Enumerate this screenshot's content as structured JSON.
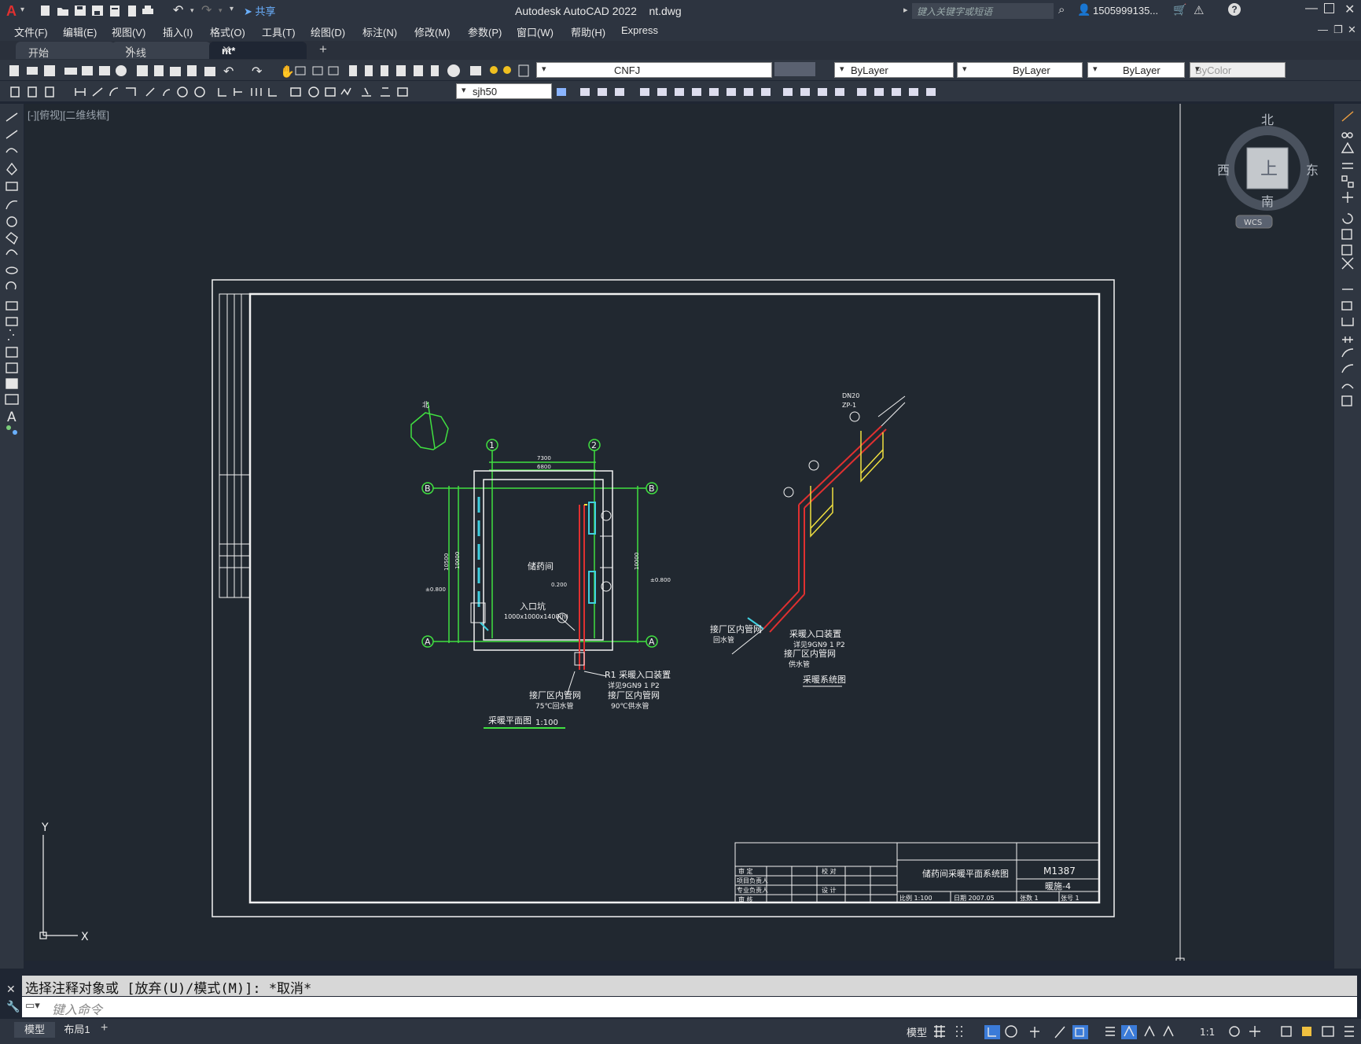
{
  "app": {
    "title": "Autodesk AutoCAD 2022    nt.dwg",
    "share": "共享",
    "search_placeholder": "键入关键字或短语",
    "user": "1505999135...",
    "colors": {
      "accent": "#e03030",
      "bg": "#1f2633",
      "canvas": "#212830"
    }
  },
  "menu": {
    "items": [
      "文件(F)",
      "编辑(E)",
      "视图(V)",
      "插入(I)",
      "格式(O)",
      "工具(T)",
      "绘图(D)",
      "标注(N)",
      "修改(M)",
      "参数(P)",
      "窗口(W)",
      "帮助(H)",
      "Express"
    ]
  },
  "tabs": [
    {
      "label": "开始"
    },
    {
      "label": "外线"
    },
    {
      "label": "nt*"
    }
  ],
  "toolbar": {
    "layer": "CNFJ",
    "color": "ByLayer",
    "linetype": "ByLayer",
    "lineweight": "ByLayer",
    "plotstyle": "ByColor",
    "textstyle": "sjh50"
  },
  "viewport": {
    "label": "[-][俯视][二维线框]",
    "viewcube": {
      "north": "北",
      "south": "南",
      "east": "东",
      "west": "西",
      "top": "上",
      "wcs": "WCS"
    },
    "ucs": {
      "x": "X",
      "y": "Y"
    }
  },
  "drawing": {
    "plan": {
      "grid_1": "1",
      "grid_2": "2",
      "grid_a": "A",
      "grid_b": "B",
      "dim_top1": "7300",
      "dim_top2": "6800",
      "dim_left1": "10500",
      "dim_left2": "10000",
      "dim_right": "10000",
      "elev_left": "±0.800",
      "elev_right": "±0.800",
      "elev_mid": "0.200",
      "room": "储药间",
      "pit": "入口坑",
      "pit_size": "1000x1000x1400(h)",
      "note_r1": "R1 采暖入口装置",
      "note_r1b": "详见9GN9 1 P2",
      "note_in1": "接厂区内管网",
      "note_in1b": "75℃回水管",
      "note_in2": "接厂区内管网",
      "note_in2b": "90℃供水管",
      "title": "采暖平面图",
      "scale": "1:100",
      "north": "北"
    },
    "system": {
      "dn": "DN20",
      "zp": "ZP-1",
      "note1": "采暖入口装置",
      "note1b": "详见9GN9 1 P2",
      "note2": "接厂区内管网",
      "note2b": "供水管",
      "note3": "接厂区内管网",
      "note3b": "回水管",
      "title": "采暖系统图"
    },
    "titleblock": {
      "r1": "审  定",
      "r2": "项目负责人",
      "r3": "专业负责人",
      "r4": "审  核",
      "c1": "校  对",
      "c2": "设  计",
      "project": "储药间采暖平面系统图",
      "code": "M1387",
      "num": "暖施-4",
      "scale": "比例 1:100",
      "date": "日期 2007.05",
      "sheets": "张数 1",
      "sheet": "张号 1"
    }
  },
  "command": {
    "history": "选择注释对象或 [放弃(U)/模式(M)]: *取消*",
    "placeholder": "键入命令"
  },
  "layout_tabs": [
    "模型",
    "布局1"
  ],
  "status": {
    "model": "模型",
    "scale": "1:1"
  }
}
